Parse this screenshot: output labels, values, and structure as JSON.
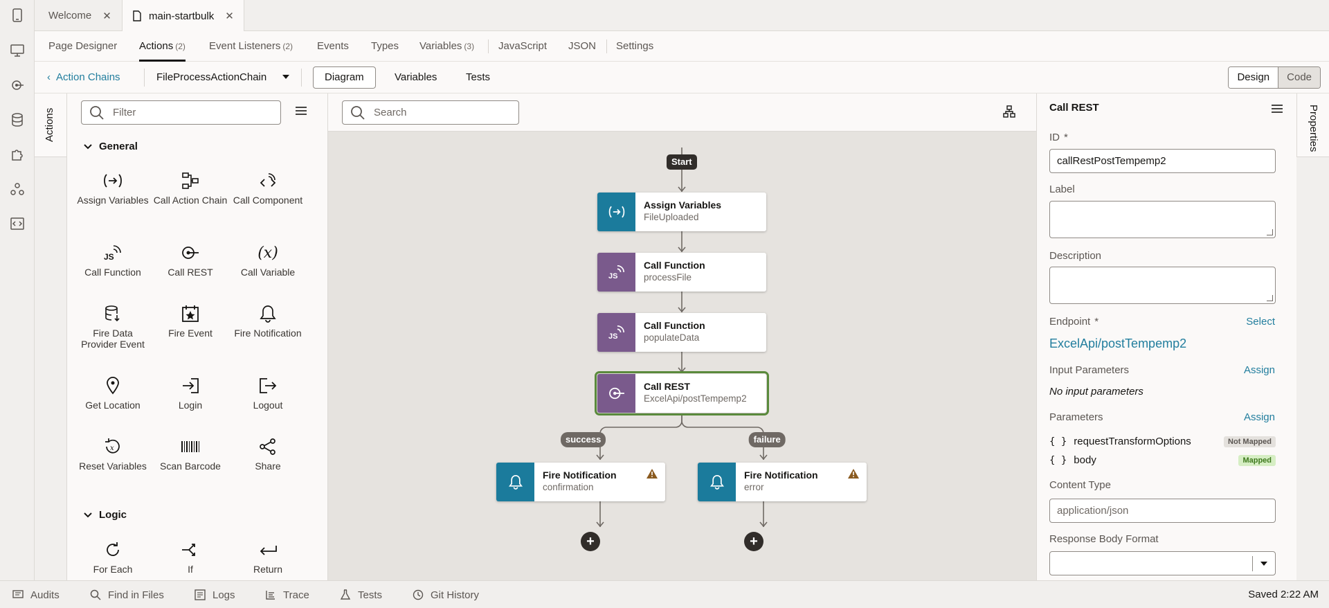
{
  "editor_tabs": [
    {
      "label": "Welcome"
    },
    {
      "label": "main-startbulk"
    }
  ],
  "designer_tabs": {
    "page_designer": "Page Designer",
    "actions": "Actions",
    "actions_count": "(2)",
    "event_listeners": "Event Listeners",
    "event_listeners_count": "(2)",
    "events": "Events",
    "types": "Types",
    "variables": "Variables",
    "variables_count": "(3)",
    "javascript": "JavaScript",
    "json": "JSON",
    "settings": "Settings"
  },
  "toolbar": {
    "back_label": "Action Chains",
    "chain_name": "FileProcessActionChain",
    "diagram": "Diagram",
    "variables": "Variables",
    "tests": "Tests",
    "design": "Design",
    "code": "Code"
  },
  "sidebar": {
    "actions_tab": "Actions",
    "properties_tab": "Properties"
  },
  "palette": {
    "filter_placeholder": "Filter",
    "general_title": "General",
    "logic_title": "Logic",
    "general_items": [
      {
        "label": "Assign Variables",
        "icon": "assign-variables-icon"
      },
      {
        "label": "Call Action Chain",
        "icon": "call-action-chain-icon"
      },
      {
        "label": "Call Component",
        "icon": "call-component-icon"
      },
      {
        "label": "Call Function",
        "icon": "call-function-icon"
      },
      {
        "label": "Call REST",
        "icon": "call-rest-icon"
      },
      {
        "label": "Call Variable",
        "icon": "call-variable-icon"
      },
      {
        "label": "Fire Data Provider Event",
        "icon": "fire-data-provider-icon"
      },
      {
        "label": "Fire Event",
        "icon": "fire-event-icon"
      },
      {
        "label": "Fire Notification",
        "icon": "bell-icon"
      },
      {
        "label": "Get Location",
        "icon": "location-pin-icon"
      },
      {
        "label": "Login",
        "icon": "login-icon"
      },
      {
        "label": "Logout",
        "icon": "logout-icon"
      },
      {
        "label": "Reset Variables",
        "icon": "reset-variables-icon"
      },
      {
        "label": "Scan Barcode",
        "icon": "barcode-icon"
      },
      {
        "label": "Share",
        "icon": "share-icon"
      }
    ],
    "logic_items": [
      {
        "label": "For Each",
        "icon": "for-each-icon"
      },
      {
        "label": "If",
        "icon": "if-icon"
      },
      {
        "label": "Return",
        "icon": "return-icon"
      }
    ]
  },
  "canvas": {
    "search_placeholder": "Search",
    "start": "Start",
    "success": "success",
    "failure": "failure",
    "nodes": [
      {
        "title": "Assign Variables",
        "subtitle": "FileUploaded"
      },
      {
        "title": "Call Function",
        "subtitle": "processFile"
      },
      {
        "title": "Call Function",
        "subtitle": "populateData"
      },
      {
        "title": "Call REST",
        "subtitle": "ExcelApi/postTempemp2"
      },
      {
        "title": "Fire Notification",
        "subtitle": "confirmation"
      },
      {
        "title": "Fire Notification",
        "subtitle": "error"
      }
    ]
  },
  "properties": {
    "title": "Call REST",
    "id_label": "ID",
    "required_mark": "*",
    "id_value": "callRestPostTempemp2",
    "label_label": "Label",
    "description_label": "Description",
    "endpoint_label": "Endpoint",
    "endpoint_select": "Select",
    "endpoint_value": "ExcelApi/postTempemp2",
    "input_params_label": "Input Parameters",
    "assign": "Assign",
    "no_input_params": "No input parameters",
    "params_label": "Parameters",
    "params": [
      {
        "name": "requestTransformOptions",
        "badge": "Not Mapped"
      },
      {
        "name": "body",
        "badge": "Mapped"
      }
    ],
    "content_type_label": "Content Type",
    "content_type_placeholder": "application/json",
    "response_format_label": "Response Body Format"
  },
  "statusbar": {
    "audits": "Audits",
    "find_in_files": "Find in Files",
    "logs": "Logs",
    "trace": "Trace",
    "tests": "Tests",
    "git_history": "Git History",
    "saved": "Saved 2:22 AM"
  },
  "colors": {
    "accent_link": "#227e9e",
    "node_teal": "#1b7b9c",
    "node_purple": "#7a5a8c",
    "selected_outline": "#5a8a3c",
    "warning": "#8a5a1f"
  }
}
